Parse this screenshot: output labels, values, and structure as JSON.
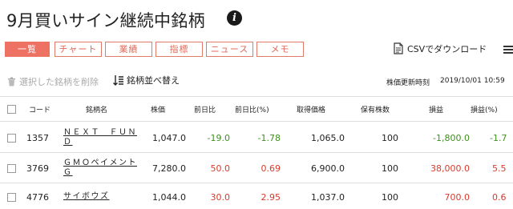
{
  "page": {
    "title": "9月買いサイン継続中銘柄",
    "info_icon": "info-icon"
  },
  "tabs": [
    {
      "label": "一覧",
      "active": true
    },
    {
      "label": "チャート",
      "active": false
    },
    {
      "label": "業績",
      "active": false
    },
    {
      "label": "指標",
      "active": false
    },
    {
      "label": "ニュース",
      "active": false
    },
    {
      "label": "メモ",
      "active": false
    }
  ],
  "toolbar": {
    "csv_label": "CSVでダウンロード",
    "delete_label": "選択した銘柄を削除",
    "sort_label": "銘柄並べ替え",
    "update_label": "株価更新時刻",
    "update_time": "2019/10/01 10:59"
  },
  "table": {
    "headers": {
      "code": "コード",
      "name": "銘柄名",
      "price": "株価",
      "change": "前日比",
      "change_pct": "前日比(%)",
      "cost": "取得価格",
      "shares": "保有株数",
      "pl": "損益",
      "pl_pct": "損益(%)"
    },
    "rows": [
      {
        "code": "1357",
        "name_line1": "ＮＥＸＴ　ＦＵＮ",
        "name_line2": "Ｄ",
        "price": "1,047.0",
        "change": "-19.0",
        "change_pct": "-1.78",
        "cost": "1,065.0",
        "shares": "100",
        "pl": "-1,800.0",
        "pl_pct": "-1.7",
        "trend": "neg"
      },
      {
        "code": "3769",
        "name_line1": "ＧＭＯペイメント",
        "name_line2": "Ｇ",
        "price": "7,280.0",
        "change": "50.0",
        "change_pct": "0.69",
        "cost": "6,900.0",
        "shares": "100",
        "pl": "38,000.0",
        "pl_pct": "5.5",
        "trend": "pos"
      },
      {
        "code": "4776",
        "name_line1": "サイボウズ",
        "name_line2": "",
        "price": "1,044.0",
        "change": "30.0",
        "change_pct": "2.95",
        "cost": "1,037.0",
        "shares": "100",
        "pl": "700.0",
        "pl_pct": "0.6",
        "trend": "pos"
      }
    ]
  },
  "colors": {
    "accent": "#ee7264",
    "positive": "#d93a2b",
    "negative": "#3f8f1f"
  }
}
